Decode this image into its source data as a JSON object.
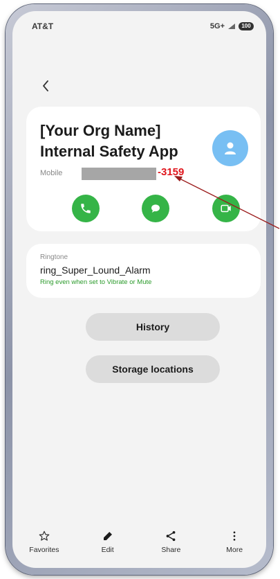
{
  "status_bar": {
    "carrier": "AT&T",
    "network": "5G+",
    "battery": "100"
  },
  "contact": {
    "name_line1": "[Your Org Name]",
    "name_line2": "Internal Safety App",
    "number_label": "Mobile",
    "number_visible_suffix": "-3159"
  },
  "ringtone": {
    "label": "Ringtone",
    "value": "ring_Super_Lound_Alarm",
    "subtext": "Ring even when set to Vibrate or Mute"
  },
  "buttons": {
    "history": "History",
    "storage": "Storage locations"
  },
  "bottom_nav": {
    "favorites": "Favorites",
    "edit": "Edit",
    "share": "Share",
    "more": "More"
  },
  "colors": {
    "action_green": "#35b447",
    "avatar_blue": "#78bff3",
    "annotation_red": "#e0161d",
    "arrow_dark_red": "#9b1b1b"
  },
  "icons": {
    "back": "chevron-left-icon",
    "avatar": "person-icon",
    "call": "phone-icon",
    "message": "chat-bubble-icon",
    "video": "video-icon",
    "favorites": "star-outline-icon",
    "edit": "pencil-icon",
    "share": "share-icon",
    "more": "more-vertical-icon"
  }
}
